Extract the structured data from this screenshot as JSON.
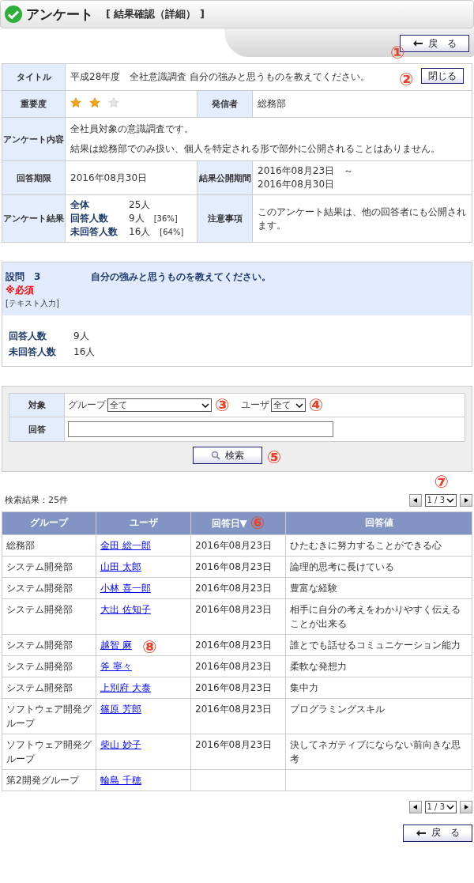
{
  "header": {
    "title": "アンケート",
    "subtitle": "[ 結果確認（詳細） ]"
  },
  "back_button": {
    "label": "戻　る",
    "callout": "①"
  },
  "info": {
    "title_label": "タイトル",
    "title": "平成28年度　全社意識調査  自分の強みと思うものを教えてください。",
    "close_button": {
      "label": "閉じる",
      "callout": "②"
    },
    "importance_label": "重要度",
    "stars": 2,
    "sender_label": "発信者",
    "sender": "総務部",
    "content_label": "アンケート内容",
    "content": [
      "全社員対象の意識調査です。",
      "結果は総務部でのみ扱い、個人を特定される形で部外に公開されることはありません。"
    ],
    "deadline_label": "回答期限",
    "deadline": "2016年08月30日",
    "period_label": "結果公開期間",
    "period": [
      "2016年08月23日　～",
      "2016年08月30日"
    ],
    "results_label": "アンケート結果",
    "results": [
      {
        "label": "全体",
        "value": "25人"
      },
      {
        "label": "回答人数",
        "value": "9人",
        "pct": "[36%]"
      },
      {
        "label": "未回答人数",
        "value": "16人",
        "pct": "[64%]"
      }
    ],
    "notes_label": "注意事項",
    "notes": "このアンケート結果は、他の回答者にも公開されます。"
  },
  "question": {
    "number": "設問　3",
    "text": "自分の強みと思うものを教えてください。",
    "required": "※必須",
    "type": "[テキスト入力]",
    "counts": [
      {
        "label": "回答人数",
        "value": "9人"
      },
      {
        "label": "未回答人数",
        "value": "16人"
      }
    ]
  },
  "search": {
    "target_label": "対象",
    "group_label": "グループ",
    "group_value": "全て",
    "group_callout": "③",
    "user_label": "ユーザ",
    "user_value": "全て",
    "user_callout": "④",
    "answer_label": "回答",
    "button": "検索",
    "button_callout": "⑤"
  },
  "result_count": "検索結果：25件",
  "pager_top": {
    "page": "1 / 3",
    "callout": "⑦"
  },
  "table": {
    "columns": [
      {
        "label": "グループ"
      },
      {
        "label": "ユーザ"
      },
      {
        "label": "回答日▼",
        "callout": "⑥"
      },
      {
        "label": "回答値"
      }
    ],
    "rows": [
      {
        "group": "総務部",
        "user": "金田 総一郎",
        "date": "2016年08月23日",
        "answer": "ひたむきに努力することができる心"
      },
      {
        "group": "システム開発部",
        "user": "山田 太郎",
        "date": "2016年08月23日",
        "answer": "論理的思考に長けている"
      },
      {
        "group": "システム開発部",
        "user": "小林 喜一郎",
        "date": "2016年08月23日",
        "answer": "豊富な経験"
      },
      {
        "group": "システム開発部",
        "user": "大出 佐知子",
        "date": "2016年08月23日",
        "answer": "相手に自分の考えをわかりやすく伝えることが出来る"
      },
      {
        "group": "システム開発部",
        "user": "越智 麻",
        "callout": "⑧",
        "date": "2016年08月23日",
        "answer": "誰とでも話せるコミュニケーション能力"
      },
      {
        "group": "システム開発部",
        "user": "斧 寧々",
        "date": "2016年08月23日",
        "answer": "柔軟な発想力"
      },
      {
        "group": "システム開発部",
        "user": "上別府 大泰",
        "date": "2016年08月23日",
        "answer": "集中力"
      },
      {
        "group": "ソフトウェア開発グループ",
        "user": "篠原 芳郎",
        "date": "2016年08月23日",
        "answer": "プログラミングスキル"
      },
      {
        "group": "ソフトウェア開発グループ",
        "user": "柴山 妙子",
        "date": "2016年08月23日",
        "answer": "決してネガティブにならない前向きな思考"
      },
      {
        "group": "第2開発グループ",
        "user": "輪島 千穂"
      }
    ]
  },
  "pager_bottom": {
    "page": "1 / 3"
  },
  "bottom_back_button": {
    "label": "戻　る"
  }
}
